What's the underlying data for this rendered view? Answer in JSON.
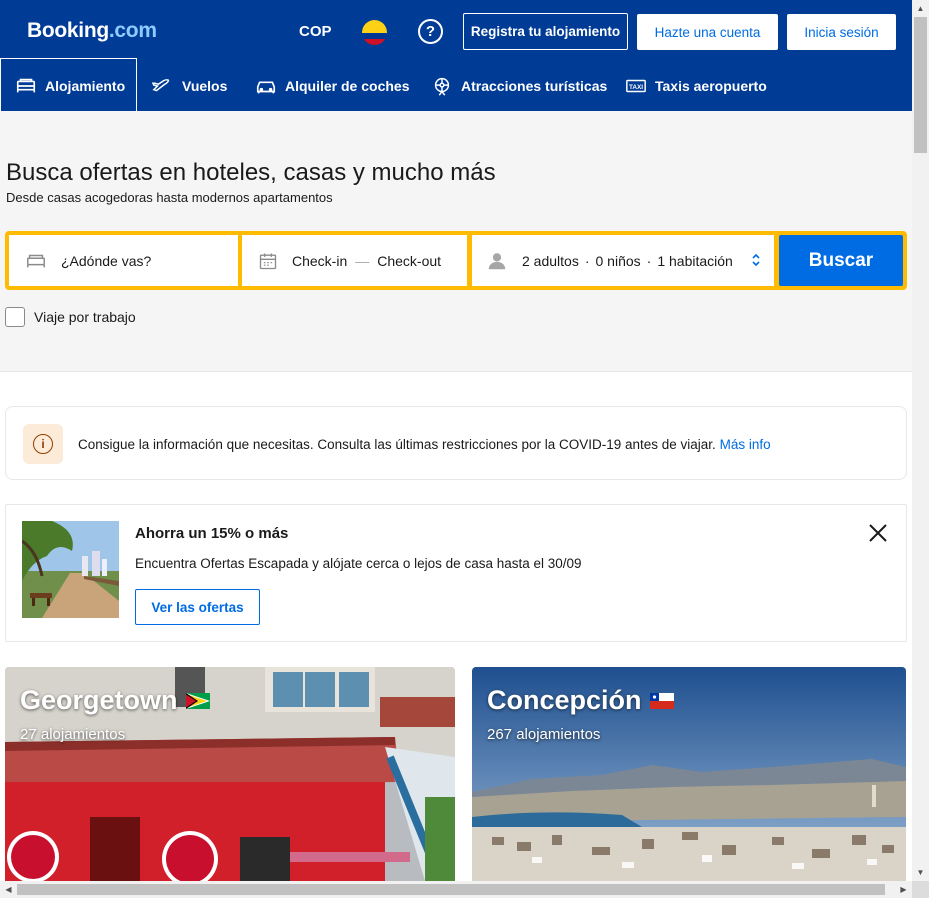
{
  "header": {
    "logo_main": "Booking",
    "logo_dot": ".com",
    "currency": "COP",
    "help_symbol": "?",
    "list_property": "Registra tu alojamiento",
    "register": "Hazte una cuenta",
    "login": "Inicia sesión"
  },
  "nav": {
    "items": [
      {
        "label": "Alojamiento",
        "icon": "bed-icon"
      },
      {
        "label": "Vuelos",
        "icon": "plane-icon"
      },
      {
        "label": "Alquiler de coches",
        "icon": "car-icon"
      },
      {
        "label": "Atracciones turísticas",
        "icon": "attractions-icon"
      },
      {
        "label": "Taxis aeropuerto",
        "icon": "taxi-icon"
      }
    ]
  },
  "hero": {
    "title": "Busca ofertas en hoteles, casas y mucho más",
    "subtitle": "Desde casas acogedoras hasta modernos apartamentos"
  },
  "search": {
    "destination_placeholder": "¿Adónde vas?",
    "checkin": "Check-in",
    "dash": "—",
    "checkout": "Check-out",
    "adults": "2 adultos",
    "children": "0 niños",
    "rooms": "1 habitación",
    "separator": "·",
    "button": "Buscar",
    "business_trip": "Viaje por trabajo"
  },
  "info": {
    "icon_symbol": "i",
    "text": "Consigue la información que necesitas. Consulta las últimas restricciones por la COVID-19 antes de viajar.",
    "link": "Más info"
  },
  "promo": {
    "title": "Ahorra un 15% o más",
    "text": "Encuentra Ofertas Escapada y alójate cerca o lejos de casa hasta el 30/09",
    "button": "Ver las ofertas"
  },
  "destinations": [
    {
      "name": "Georgetown",
      "count": "27 alojamientos",
      "flag": "guyana-flag"
    },
    {
      "name": "Concepción",
      "count": "267 alojamientos",
      "flag": "chile-flag"
    }
  ],
  "colors": {
    "brand_blue": "#003b95",
    "action_blue": "#006ce4",
    "search_yellow": "#febb02"
  }
}
